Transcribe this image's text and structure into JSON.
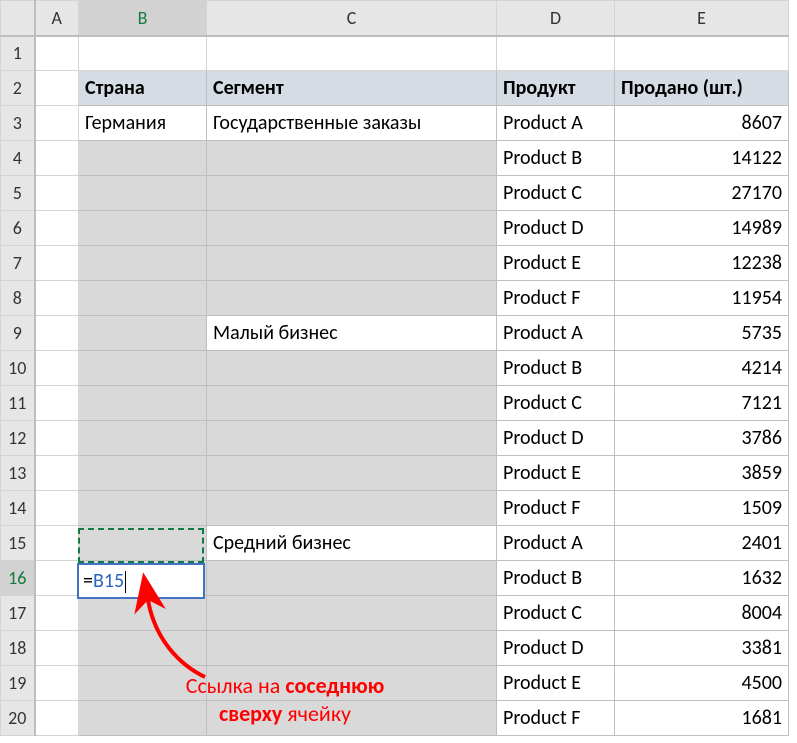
{
  "columns": {
    "A": "A",
    "B": "B",
    "C": "C",
    "D": "D",
    "E": "E"
  },
  "rows": [
    "1",
    "2",
    "3",
    "4",
    "5",
    "6",
    "7",
    "8",
    "9",
    "10",
    "11",
    "12",
    "13",
    "14",
    "15",
    "16",
    "17",
    "18",
    "19",
    "20"
  ],
  "header": {
    "country": "Страна",
    "segment": "Сегмент",
    "product": "Продукт",
    "sold": "Продано (шт.)"
  },
  "data": [
    {
      "country": "Германия",
      "segment": "Государственные заказы",
      "product": "Product A",
      "sold": "8607"
    },
    {
      "country": "",
      "segment": "",
      "product": "Product B",
      "sold": "14122"
    },
    {
      "country": "",
      "segment": "",
      "product": "Product C",
      "sold": "27170"
    },
    {
      "country": "",
      "segment": "",
      "product": "Product D",
      "sold": "14989"
    },
    {
      "country": "",
      "segment": "",
      "product": "Product E",
      "sold": "12238"
    },
    {
      "country": "",
      "segment": "",
      "product": "Product F",
      "sold": "11954"
    },
    {
      "country": "",
      "segment": "Малый бизнес",
      "product": "Product A",
      "sold": "5735"
    },
    {
      "country": "",
      "segment": "",
      "product": "Product B",
      "sold": "4214"
    },
    {
      "country": "",
      "segment": "",
      "product": "Product C",
      "sold": "7121"
    },
    {
      "country": "",
      "segment": "",
      "product": "Product D",
      "sold": "3786"
    },
    {
      "country": "",
      "segment": "",
      "product": "Product E",
      "sold": "3859"
    },
    {
      "country": "",
      "segment": "",
      "product": "Product F",
      "sold": "1509"
    },
    {
      "country": "",
      "segment": "Средний бизнес",
      "product": "Product A",
      "sold": "2401"
    },
    {
      "country": "",
      "segment": "",
      "product": "Product B",
      "sold": "1632"
    },
    {
      "country": "",
      "segment": "",
      "product": "Product C",
      "sold": "8004"
    },
    {
      "country": "",
      "segment": "",
      "product": "Product D",
      "sold": "3381"
    },
    {
      "country": "",
      "segment": "",
      "product": "Product E",
      "sold": "4500"
    },
    {
      "country": "",
      "segment": "",
      "product": "Product F",
      "sold": "1681"
    }
  ],
  "formula": {
    "eq": "=",
    "ref": "B15"
  },
  "annotation": {
    "line1_a": "Ссылка на ",
    "line1_b": "соседнюю",
    "line2_a": "сверху",
    "line2_b": " ячейку"
  }
}
